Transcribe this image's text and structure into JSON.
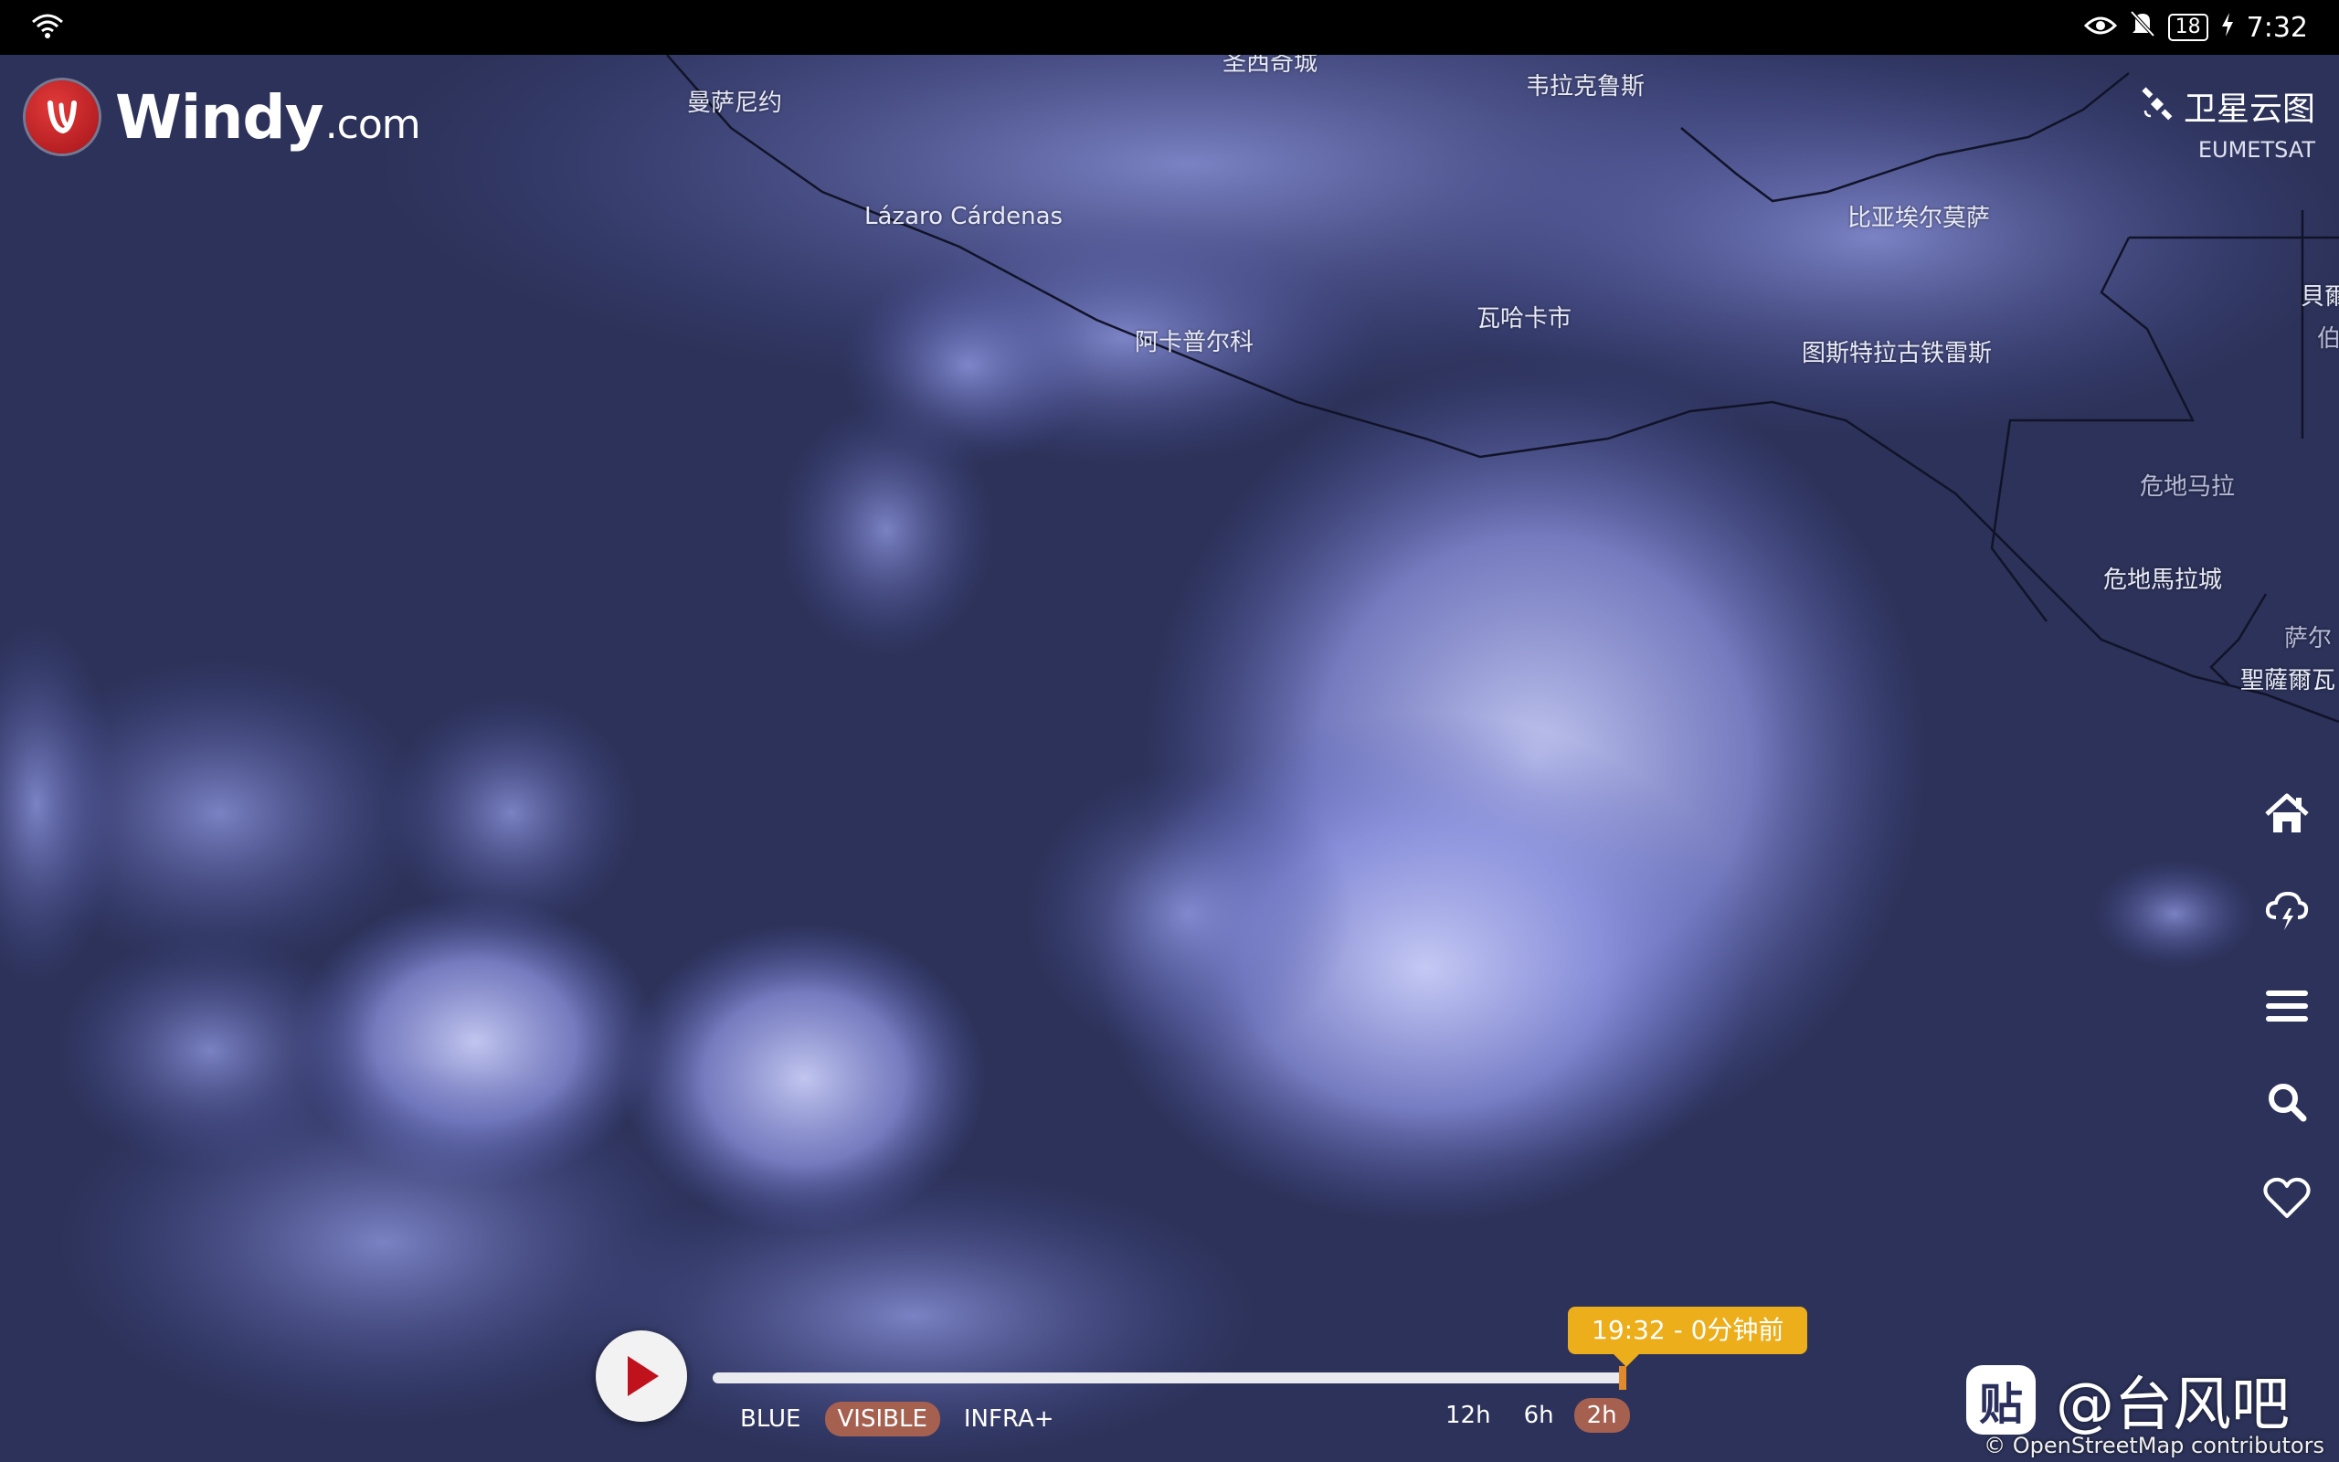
{
  "status_bar": {
    "battery": "18",
    "time": "7:32"
  },
  "brand": {
    "name": "Windy",
    "domain": ".com"
  },
  "layer": {
    "title": "卫星云图",
    "source": "EUMETSAT"
  },
  "places": [
    {
      "id": "san-cristobal",
      "label": "圣西奇城"
    },
    {
      "id": "manzanillo",
      "label": "曼萨尼约"
    },
    {
      "id": "veracruz",
      "label": "韦拉克鲁斯"
    },
    {
      "id": "lazaro-cardenas",
      "label": "Lázaro Cárdenas"
    },
    {
      "id": "villahermosa",
      "label": "比亚埃尔莫萨"
    },
    {
      "id": "oaxaca",
      "label": "瓦哈卡市"
    },
    {
      "id": "acapulco",
      "label": "阿卡普尔科"
    },
    {
      "id": "tuxtla",
      "label": "图斯特拉古铁雷斯"
    },
    {
      "id": "guatemala-country",
      "label": "危地马拉"
    },
    {
      "id": "guatemala-city",
      "label": "危地馬拉城"
    },
    {
      "id": "san-salvador-cut",
      "label": "聖薩爾瓦"
    },
    {
      "id": "el-salvador-cut",
      "label": "萨尔"
    },
    {
      "id": "belize-cut",
      "label": "貝爾"
    },
    {
      "id": "belize-cut2",
      "label": "伯"
    }
  ],
  "timeline": {
    "tooltip": "19:32 - 0分钟前",
    "progress": 1.0,
    "channels": [
      "BLUE",
      "VISIBLE",
      "INFRA+"
    ],
    "active_channel": "VISIBLE",
    "ranges": [
      "12h",
      "6h",
      "2h"
    ],
    "active_range": "2h"
  },
  "watermark": {
    "icon_char": "贴",
    "text": "@台风吧"
  },
  "attribution": "© OpenStreetMap contributors",
  "colors": {
    "accent": "#ecae1a",
    "active_chip": "#a56050",
    "brand_red": "#c8202a"
  }
}
